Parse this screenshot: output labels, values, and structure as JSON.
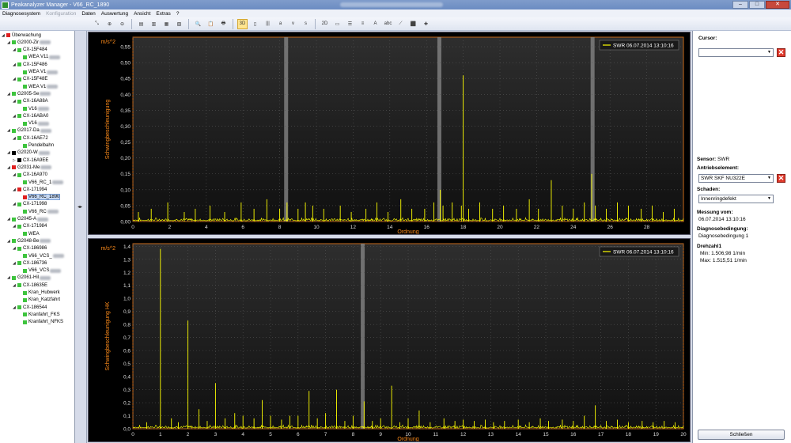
{
  "window": {
    "title": "Peakanalyzer Manager - V66_RC_1890",
    "controls": [
      "–",
      "□",
      "✕"
    ]
  },
  "menu": [
    {
      "label": "Diagnosesystem",
      "disabled": false
    },
    {
      "label": "Konfiguration",
      "disabled": true
    },
    {
      "label": "Daten",
      "disabled": false
    },
    {
      "label": "Auswertung",
      "disabled": false
    },
    {
      "label": "Ansicht",
      "disabled": false
    },
    {
      "label": "Extras",
      "disabled": false
    },
    {
      "label": "?",
      "disabled": false
    }
  ],
  "toolbar": [
    {
      "icon": "fit-all-icon",
      "glyph": "⤡"
    },
    {
      "icon": "zoom-in-icon",
      "glyph": "⊕"
    },
    {
      "icon": "zoom-out-icon",
      "glyph": "⊖"
    },
    {
      "sep": true
    },
    {
      "icon": "spectrum-view-icon",
      "glyph": "▤"
    },
    {
      "icon": "spectrum-compare-icon",
      "glyph": "▥"
    },
    {
      "icon": "spectrum-overlay-icon",
      "glyph": "▦"
    },
    {
      "icon": "spectrum-table-icon",
      "glyph": "▧"
    },
    {
      "sep": true
    },
    {
      "icon": "search-icon",
      "glyph": "🔍"
    },
    {
      "icon": "clipboard-icon",
      "glyph": "📋"
    },
    {
      "icon": "print-icon",
      "glyph": "🖶"
    },
    {
      "sep": true
    },
    {
      "icon": "3d-view-icon",
      "glyph": "3D",
      "active": true
    },
    {
      "icon": "waterfall-icon",
      "glyph": "▯"
    },
    {
      "icon": "bars-icon",
      "glyph": "|||"
    },
    {
      "icon": "italic-a-icon",
      "glyph": "a"
    },
    {
      "icon": "italic-v-icon",
      "glyph": "v"
    },
    {
      "icon": "italic-s-icon",
      "glyph": "s"
    },
    {
      "sep": true
    },
    {
      "icon": "2d-view-icon",
      "glyph": "2D"
    },
    {
      "icon": "frame-icon",
      "glyph": "▭"
    },
    {
      "icon": "list-view-icon",
      "glyph": "☰"
    },
    {
      "icon": "legend-icon",
      "glyph": "≡"
    },
    {
      "icon": "text-a-icon",
      "glyph": "A"
    },
    {
      "icon": "text-abc-icon",
      "glyph": "abc"
    },
    {
      "icon": "trend-line-icon",
      "glyph": "⟋"
    },
    {
      "icon": "marker-icon",
      "glyph": "⬛"
    },
    {
      "icon": "cursor-cross-icon",
      "glyph": "✚"
    }
  ],
  "tree": [
    {
      "level": 0,
      "label": "Überwachung",
      "color": "#e02020",
      "exp": "◢",
      "blur": false
    },
    {
      "level": 1,
      "label": "G2000-Zir",
      "color": "#3ec43e",
      "exp": "◢",
      "blur": true
    },
    {
      "level": 2,
      "label": "CX-15F484",
      "color": "#3ec43e",
      "exp": "◢",
      "blur": false
    },
    {
      "level": 3,
      "label": "WEA V11",
      "color": "#3ec43e",
      "exp": "",
      "blur": true
    },
    {
      "level": 2,
      "label": "CX-15F486",
      "color": "#3ec43e",
      "exp": "◢",
      "blur": false
    },
    {
      "level": 3,
      "label": "WEA V1",
      "color": "#3ec43e",
      "exp": "",
      "blur": true
    },
    {
      "level": 2,
      "label": "CX-15F48E",
      "color": "#3ec43e",
      "exp": "◢",
      "blur": false
    },
    {
      "level": 3,
      "label": "WEA V1",
      "color": "#3ec43e",
      "exp": "",
      "blur": true
    },
    {
      "level": 1,
      "label": "G2005-Se",
      "color": "#3ec43e",
      "exp": "◢",
      "blur": true
    },
    {
      "level": 2,
      "label": "CX-16A88A",
      "color": "#3ec43e",
      "exp": "◢",
      "blur": false
    },
    {
      "level": 3,
      "label": "V16",
      "color": "#3ec43e",
      "exp": "",
      "blur": true
    },
    {
      "level": 2,
      "label": "CX-16ABA0",
      "color": "#3ec43e",
      "exp": "◢",
      "blur": false
    },
    {
      "level": 3,
      "label": "V16",
      "color": "#3ec43e",
      "exp": "",
      "blur": true
    },
    {
      "level": 1,
      "label": "G2017-Da",
      "color": "#3ec43e",
      "exp": "◢",
      "blur": true
    },
    {
      "level": 2,
      "label": "CX-16AE72",
      "color": "#3ec43e",
      "exp": "◢",
      "blur": false
    },
    {
      "level": 3,
      "label": "Pendelbahn",
      "color": "#3ec43e",
      "exp": "",
      "blur": false
    },
    {
      "level": 1,
      "label": "G2020-W",
      "color": "#000000",
      "exp": "◢",
      "blur": true
    },
    {
      "level": 2,
      "label": "CX-16A9EE",
      "color": "#000000",
      "exp": "▷",
      "blur": false
    },
    {
      "level": 1,
      "label": "G2031-Me",
      "color": "#e02020",
      "exp": "◢",
      "blur": true
    },
    {
      "level": 2,
      "label": "CX-16A970",
      "color": "#3ec43e",
      "exp": "◢",
      "blur": false
    },
    {
      "level": 3,
      "label": "V66_RC_1",
      "color": "#3ec43e",
      "exp": "",
      "blur": true
    },
    {
      "level": 2,
      "label": "CX-171994",
      "color": "#e02020",
      "exp": "◢",
      "blur": false
    },
    {
      "level": 3,
      "label": "V66_RC_1890",
      "color": "#e02020",
      "exp": "",
      "blur": false,
      "selected": true
    },
    {
      "level": 2,
      "label": "CX-171998",
      "color": "#3ec43e",
      "exp": "◢",
      "blur": false
    },
    {
      "level": 3,
      "label": "V66_RC",
      "color": "#3ec43e",
      "exp": "",
      "blur": true
    },
    {
      "level": 1,
      "label": "G2045-A",
      "color": "#3ec43e",
      "exp": "◢",
      "blur": true
    },
    {
      "level": 2,
      "label": "CX-171984",
      "color": "#3ec43e",
      "exp": "◢",
      "blur": false
    },
    {
      "level": 3,
      "label": "WEA",
      "color": "#3ec43e",
      "exp": "",
      "blur": false
    },
    {
      "level": 1,
      "label": "G2048-Be",
      "color": "#3ec43e",
      "exp": "◢",
      "blur": true
    },
    {
      "level": 2,
      "label": "CX-186986",
      "color": "#3ec43e",
      "exp": "◢",
      "blur": false
    },
    {
      "level": 3,
      "label": "V66_VCS_",
      "color": "#3ec43e",
      "exp": "",
      "blur": true
    },
    {
      "level": 2,
      "label": "CX-186736",
      "color": "#3ec43e",
      "exp": "◢",
      "blur": false
    },
    {
      "level": 3,
      "label": "V66_VCS",
      "color": "#3ec43e",
      "exp": "",
      "blur": true
    },
    {
      "level": 1,
      "label": "G2061-Hil",
      "color": "#3ec43e",
      "exp": "◢",
      "blur": true
    },
    {
      "level": 2,
      "label": "CX-18635E",
      "color": "#3ec43e",
      "exp": "◢",
      "blur": false
    },
    {
      "level": 3,
      "label": "Kran_Hubwerk",
      "color": "#3ec43e",
      "exp": "",
      "blur": false
    },
    {
      "level": 3,
      "label": "Kran_Katzfahrt",
      "color": "#3ec43e",
      "exp": "",
      "blur": false
    },
    {
      "level": 2,
      "label": "CX-186544",
      "color": "#3ec43e",
      "exp": "◢",
      "blur": false
    },
    {
      "level": 3,
      "label": "Kranfahrt_FKS",
      "color": "#3ec43e",
      "exp": "",
      "blur": false
    },
    {
      "level": 3,
      "label": "Kranfahrt_NFKS",
      "color": "#3ec43e",
      "exp": "",
      "blur": false
    }
  ],
  "chart_data": [
    {
      "type": "line",
      "title": "",
      "xlabel": "Ordnung",
      "ylabel": "Schwingbeschleunigung",
      "yunit": "m/s^2",
      "xlim": [
        0,
        30
      ],
      "ylim": [
        0,
        0.58
      ],
      "xticks": [
        0,
        2,
        4,
        6,
        8,
        10,
        12,
        14,
        16,
        18,
        20,
        22,
        24,
        26,
        28
      ],
      "yticks": [
        0.0,
        0.05,
        0.1,
        0.15,
        0.2,
        0.25,
        0.3,
        0.35,
        0.4,
        0.45,
        0.5,
        0.55
      ],
      "ytick_labels": [
        "0,00",
        "0,05",
        "0,10",
        "0,15",
        "0,20",
        "0,25",
        "0,30",
        "0,35",
        "0,40",
        "0,45",
        "0,50",
        "0,55"
      ],
      "legend": "SWR 06.07.2014 13:10:16",
      "legend_position": "top-right",
      "highlight_bands": [
        8.35,
        16.7,
        25.05
      ],
      "grid": true,
      "series": [
        {
          "color": "#ffff00",
          "peaks": [
            {
              "x": 0.3,
              "y": 0.03
            },
            {
              "x": 1.0,
              "y": 0.04
            },
            {
              "x": 1.9,
              "y": 0.06
            },
            {
              "x": 2.8,
              "y": 0.03
            },
            {
              "x": 3.4,
              "y": 0.04
            },
            {
              "x": 4.2,
              "y": 0.05
            },
            {
              "x": 5.0,
              "y": 0.03
            },
            {
              "x": 5.9,
              "y": 0.06
            },
            {
              "x": 6.6,
              "y": 0.04
            },
            {
              "x": 7.3,
              "y": 0.07
            },
            {
              "x": 8.0,
              "y": 0.04
            },
            {
              "x": 8.4,
              "y": 0.06
            },
            {
              "x": 9.0,
              "y": 0.04
            },
            {
              "x": 9.4,
              "y": 0.06
            },
            {
              "x": 9.8,
              "y": 0.05
            },
            {
              "x": 10.4,
              "y": 0.04
            },
            {
              "x": 11.3,
              "y": 0.05
            },
            {
              "x": 11.9,
              "y": 0.03
            },
            {
              "x": 12.7,
              "y": 0.04
            },
            {
              "x": 13.3,
              "y": 0.06
            },
            {
              "x": 13.9,
              "y": 0.03
            },
            {
              "x": 14.6,
              "y": 0.07
            },
            {
              "x": 15.2,
              "y": 0.04
            },
            {
              "x": 15.9,
              "y": 0.04
            },
            {
              "x": 16.4,
              "y": 0.06
            },
            {
              "x": 16.75,
              "y": 0.1
            },
            {
              "x": 16.9,
              "y": 0.05
            },
            {
              "x": 17.4,
              "y": 0.06
            },
            {
              "x": 17.9,
              "y": 0.05
            },
            {
              "x": 18.0,
              "y": 0.46
            },
            {
              "x": 18.3,
              "y": 0.04
            },
            {
              "x": 18.9,
              "y": 0.06
            },
            {
              "x": 19.6,
              "y": 0.04
            },
            {
              "x": 20.2,
              "y": 0.05
            },
            {
              "x": 20.9,
              "y": 0.04
            },
            {
              "x": 21.6,
              "y": 0.07
            },
            {
              "x": 22.1,
              "y": 0.04
            },
            {
              "x": 22.8,
              "y": 0.13
            },
            {
              "x": 23.4,
              "y": 0.05
            },
            {
              "x": 24.0,
              "y": 0.04
            },
            {
              "x": 24.6,
              "y": 0.06
            },
            {
              "x": 25.0,
              "y": 0.15
            },
            {
              "x": 25.2,
              "y": 0.05
            },
            {
              "x": 25.8,
              "y": 0.04
            },
            {
              "x": 26.4,
              "y": 0.06
            },
            {
              "x": 27.0,
              "y": 0.05
            },
            {
              "x": 27.7,
              "y": 0.04
            },
            {
              "x": 28.3,
              "y": 0.05
            },
            {
              "x": 28.9,
              "y": 0.03
            },
            {
              "x": 29.5,
              "y": 0.04
            }
          ]
        }
      ]
    },
    {
      "type": "line",
      "title": "",
      "xlabel": "Ordnung",
      "ylabel": "Schwingbeschleunigung HK",
      "yunit": "m/s^2",
      "xlim": [
        0,
        20
      ],
      "ylim": [
        0,
        1.42
      ],
      "xticks": [
        0,
        1,
        2,
        3,
        4,
        5,
        6,
        7,
        8,
        9,
        10,
        11,
        12,
        13,
        14,
        15,
        16,
        17,
        18,
        19,
        20
      ],
      "yticks": [
        0.0,
        0.1,
        0.2,
        0.3,
        0.4,
        0.5,
        0.6,
        0.7,
        0.8,
        0.9,
        1.0,
        1.1,
        1.2,
        1.3,
        1.4
      ],
      "ytick_labels": [
        "0,0",
        "0,1",
        "0,2",
        "0,3",
        "0,4",
        "0,5",
        "0,6",
        "0,7",
        "0,8",
        "0,9",
        "1,0",
        "1,1",
        "1,2",
        "1,3",
        "1,4"
      ],
      "legend": "SWR 06.07.2014 13:10:16",
      "legend_position": "top-right",
      "highlight_bands": [
        8.35
      ],
      "grid": true,
      "series": [
        {
          "color": "#ffff00",
          "peaks": [
            {
              "x": 0.5,
              "y": 0.05
            },
            {
              "x": 1.0,
              "y": 1.38
            },
            {
              "x": 1.4,
              "y": 0.08
            },
            {
              "x": 1.65,
              "y": 0.05
            },
            {
              "x": 2.0,
              "y": 0.83
            },
            {
              "x": 2.4,
              "y": 0.15
            },
            {
              "x": 2.7,
              "y": 0.06
            },
            {
              "x": 3.0,
              "y": 0.35
            },
            {
              "x": 3.35,
              "y": 0.08
            },
            {
              "x": 3.7,
              "y": 0.12
            },
            {
              "x": 4.0,
              "y": 0.1
            },
            {
              "x": 4.4,
              "y": 0.08
            },
            {
              "x": 4.7,
              "y": 0.22
            },
            {
              "x": 5.0,
              "y": 0.1
            },
            {
              "x": 5.4,
              "y": 0.07
            },
            {
              "x": 5.7,
              "y": 0.1
            },
            {
              "x": 6.0,
              "y": 0.1
            },
            {
              "x": 6.4,
              "y": 0.29
            },
            {
              "x": 6.7,
              "y": 0.08
            },
            {
              "x": 7.0,
              "y": 0.12
            },
            {
              "x": 7.4,
              "y": 0.3
            },
            {
              "x": 7.7,
              "y": 0.06
            },
            {
              "x": 8.0,
              "y": 0.1
            },
            {
              "x": 8.4,
              "y": 0.21
            },
            {
              "x": 8.7,
              "y": 0.06
            },
            {
              "x": 9.0,
              "y": 0.08
            },
            {
              "x": 9.4,
              "y": 0.33
            },
            {
              "x": 9.7,
              "y": 0.05
            },
            {
              "x": 10.0,
              "y": 0.08
            },
            {
              "x": 10.4,
              "y": 0.14
            },
            {
              "x": 10.8,
              "y": 0.05
            },
            {
              "x": 11.3,
              "y": 0.08
            },
            {
              "x": 11.7,
              "y": 0.06
            },
            {
              "x": 12.0,
              "y": 0.07
            },
            {
              "x": 12.4,
              "y": 0.06
            },
            {
              "x": 12.8,
              "y": 0.07
            },
            {
              "x": 13.1,
              "y": 0.05
            },
            {
              "x": 13.5,
              "y": 0.06
            },
            {
              "x": 14.0,
              "y": 0.07
            },
            {
              "x": 14.4,
              "y": 0.05
            },
            {
              "x": 14.8,
              "y": 0.08
            },
            {
              "x": 15.1,
              "y": 0.06
            },
            {
              "x": 15.6,
              "y": 0.07
            },
            {
              "x": 16.0,
              "y": 0.06
            },
            {
              "x": 16.4,
              "y": 0.1
            },
            {
              "x": 16.8,
              "y": 0.18
            },
            {
              "x": 17.2,
              "y": 0.06
            },
            {
              "x": 17.6,
              "y": 0.07
            },
            {
              "x": 18.0,
              "y": 0.05
            },
            {
              "x": 18.5,
              "y": 0.06
            },
            {
              "x": 18.9,
              "y": 0.05
            },
            {
              "x": 19.3,
              "y": 0.06
            },
            {
              "x": 19.7,
              "y": 0.05
            }
          ]
        }
      ]
    }
  ],
  "panel": {
    "cursor_label": "Cursor:",
    "cursor_value": "",
    "sensor_label": "Sensor:",
    "sensor_value": "SWR",
    "antrieb_label": "Antriebselement:",
    "antrieb_value": "SWR SKF NU322E",
    "schaden_label": "Schaden:",
    "schaden_value": "Innenringdefekt",
    "messung_label": "Messung vom:",
    "messung_value": "06.07.2014 13:10:16",
    "diag_label": "Diagnosebedingung:",
    "diag_value": "Diagnosebedingung 1",
    "drehzahl_label": "Drehzahl1",
    "min_label": "Min:",
    "min_value": "1.506,98",
    "max_label": "Max:",
    "max_value": "1.515,51",
    "unit": "1/min",
    "close_label": "Schließen"
  }
}
